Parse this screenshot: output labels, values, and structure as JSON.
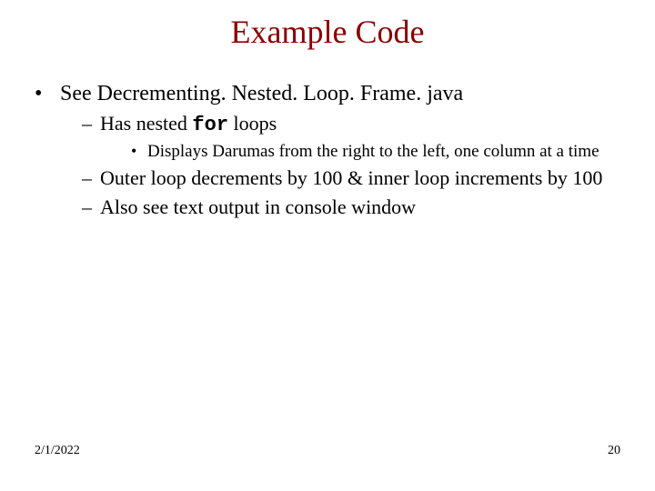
{
  "title": "Example Code",
  "bullets": {
    "top": "See Decrementing. Nested. Loop. Frame. java",
    "sub1_pre": "Has nested ",
    "sub1_code": "for",
    "sub1_post": " loops",
    "subsub1": "Displays Darumas from the right to the left, one column at a time",
    "sub2": "Outer loop decrements by 100 & inner loop increments by 100",
    "sub3": "Also see text output in console window"
  },
  "footer": {
    "date": "2/1/2022",
    "page": "20"
  }
}
